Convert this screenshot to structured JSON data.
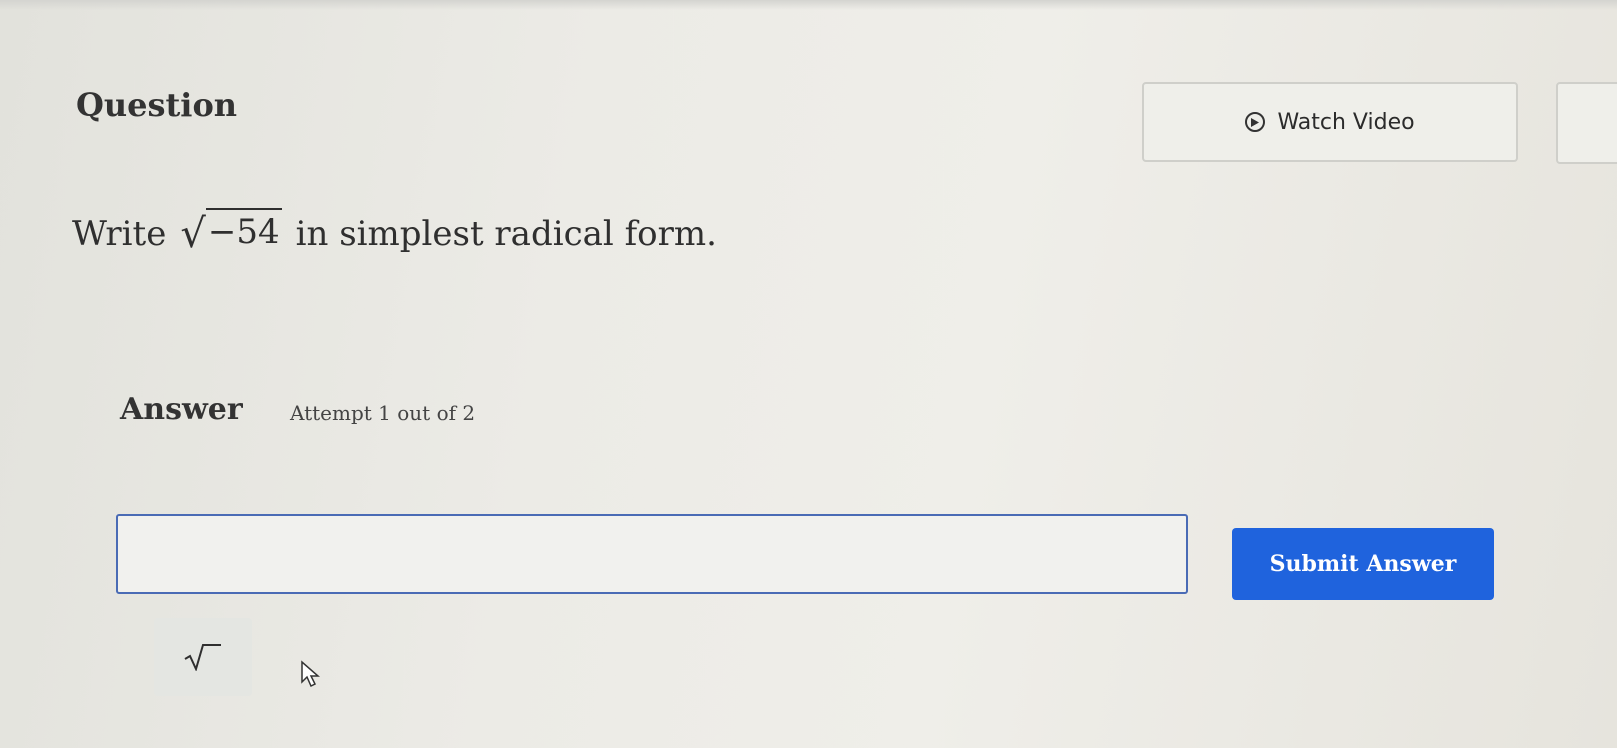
{
  "header": {
    "title": "Question",
    "video_button": {
      "label": "Watch Video",
      "icon": "play-circle-icon"
    }
  },
  "question": {
    "prefix": "Write",
    "radicand": "−54",
    "suffix": "in simplest radical form."
  },
  "answer": {
    "heading": "Answer",
    "attempt_text": "Attempt 1 out of 2",
    "input_value": "",
    "submit_label": "Submit Answer"
  },
  "toolbar": {
    "sqrt_button_icon": "square-root-icon"
  },
  "colors": {
    "submit": "#1f63dd",
    "input_border": "#4a6bb5"
  }
}
